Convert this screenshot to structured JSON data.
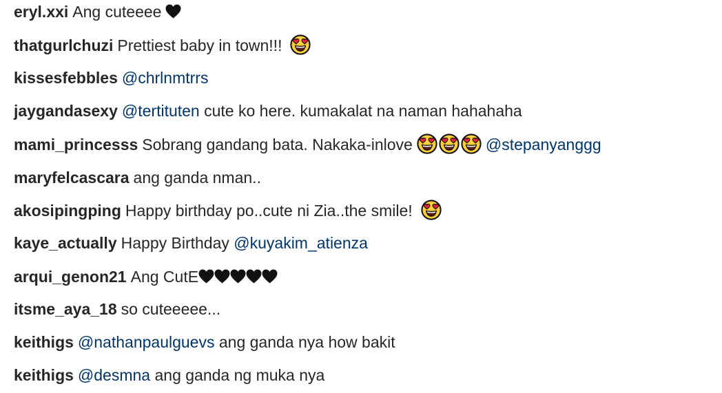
{
  "comments": [
    {
      "user": "eryl.xxi",
      "text": "Ang cuteeee",
      "icon": "black-heart-icon"
    },
    {
      "user": "thatgurlchuzi",
      "text": "Prettiest baby in town!!!",
      "icon": "heart-eyes-icon"
    },
    {
      "user": "kissesfebbles",
      "mention": "@chrlnmtrrs"
    },
    {
      "user": "jaygandasexy",
      "mention": "@tertituten",
      "text": "cute ko here. kumakalat na naman hahahaha"
    },
    {
      "user": "mami_princesss",
      "text": "Sobrang gandang bata. Nakaka-inlove",
      "icons": [
        "heart-eyes-icon",
        "heart-eyes-icon",
        "heart-eyes-icon"
      ],
      "mention": "@stepanyanggg"
    },
    {
      "user": "maryfelcascara",
      "text": "ang ganda nman.."
    },
    {
      "user": "akosipingping",
      "text": "Happy birthday po..cute ni Zia..the smile!",
      "icon": "heart-eyes-icon"
    },
    {
      "user": "kaye_actually",
      "text": "Happy Birthday",
      "mention": "@kuyakim_atienza"
    },
    {
      "user": "arqui_genon21",
      "text": "Ang CutE",
      "icons": [
        "black-heart-icon",
        "black-heart-icon",
        "black-heart-icon",
        "black-heart-icon",
        "black-heart-icon"
      ]
    },
    {
      "user": "itsme_aya_18",
      "text": "so cuteeeee..."
    },
    {
      "user": "keithigs",
      "mention": "@nathanpaulguevs",
      "text": "ang ganda nya how bakit"
    },
    {
      "user": "keithigs",
      "mention": "@desmna",
      "text": "ang ganda ng muka nya"
    }
  ],
  "colors": {
    "username": "#262626",
    "text": "#262626",
    "mention": "#003569",
    "background": "#ffffff"
  }
}
